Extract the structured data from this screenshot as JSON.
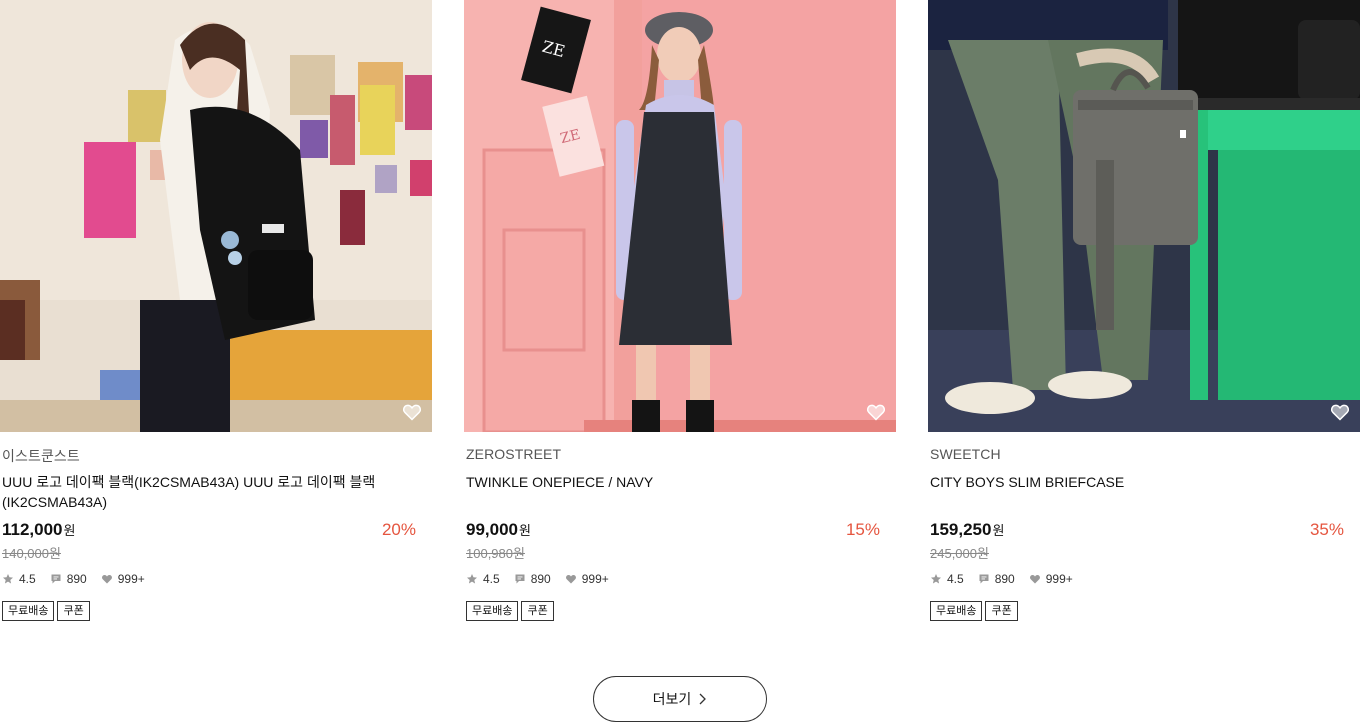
{
  "products": [
    {
      "brand": "이스트쿤스트",
      "name": "UUU 로고 데이팩 블랙(IK2CSMAB43A) UUU 로고 데이팩 블랙(IK2CSMAB43A)",
      "price": "112,000",
      "currency": "원",
      "discount": "20%",
      "original_price": "140,000원",
      "rating": "4.5",
      "reviews": "890",
      "likes": "999+",
      "tags": [
        "무료배송",
        "쿠폰"
      ],
      "image": "model-with-black-backpack"
    },
    {
      "brand": "ZEROSTREET",
      "name": "TWINKLE ONEPIECE / NAVY",
      "price": "99,000",
      "currency": "원",
      "discount": "15%",
      "original_price": "100,980원",
      "rating": "4.5",
      "reviews": "890",
      "likes": "999+",
      "tags": [
        "무료배송",
        "쿠폰"
      ],
      "image": "model-in-navy-dress"
    },
    {
      "brand": "SWEETCH",
      "name": "CITY BOYS SLIM BRIEFCASE",
      "price": "159,250",
      "currency": "원",
      "discount": "35%",
      "original_price": "245,000원",
      "rating": "4.5",
      "reviews": "890",
      "likes": "999+",
      "tags": [
        "무료배송",
        "쿠폰"
      ],
      "image": "model-with-grey-briefcase"
    }
  ],
  "more_button": {
    "label": "더보기"
  },
  "icons": {
    "wishlist": "heart-outline-icon",
    "rating": "star-icon",
    "reviews": "comment-icon",
    "likes": "heart-icon",
    "more": "chevron-right-icon"
  },
  "colors": {
    "discount": "#e5553f",
    "text": "#111111",
    "muted": "#888888"
  }
}
